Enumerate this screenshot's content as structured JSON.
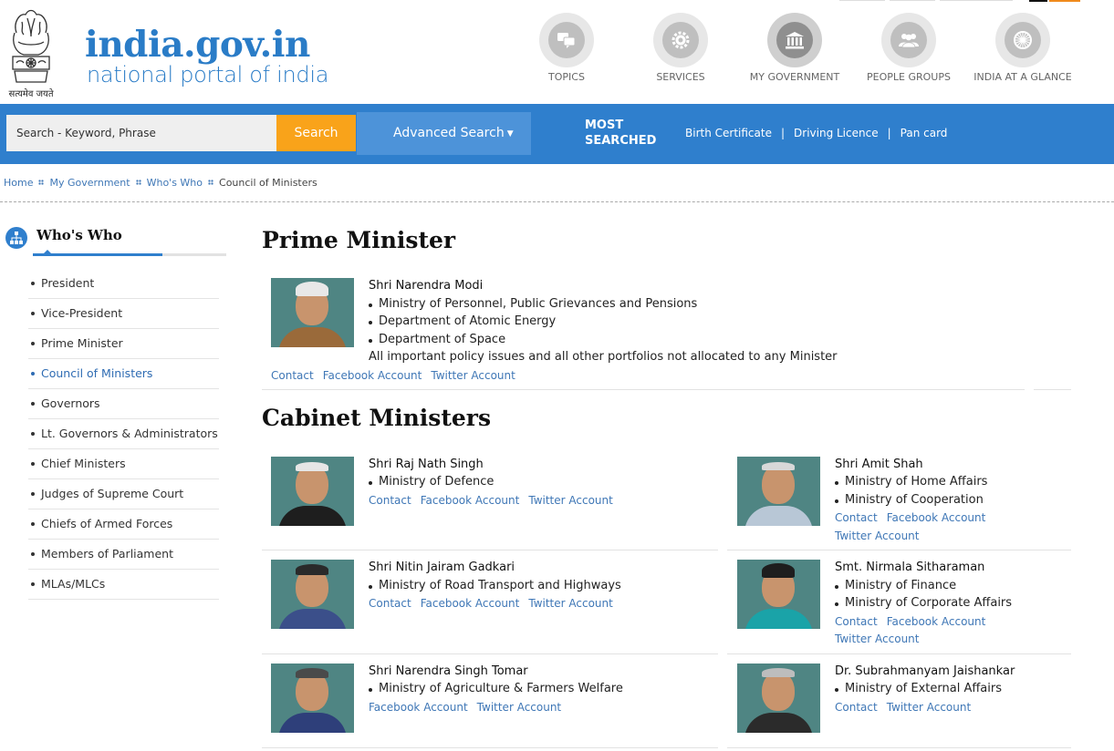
{
  "header": {
    "emblem_caption": "सत्यमेव जयते",
    "site_name": "india.gov.in",
    "site_tagline": "national portal of india",
    "nav": [
      {
        "label": "TOPICS",
        "icon": "chat-bubbles-icon"
      },
      {
        "label": "SERVICES",
        "icon": "gear-icon"
      },
      {
        "label": "MY GOVERNMENT",
        "icon": "government-building-icon"
      },
      {
        "label": "PEOPLE GROUPS",
        "icon": "people-group-icon"
      },
      {
        "label": "INDIA AT A GLANCE",
        "icon": "ashoka-chakra-icon"
      }
    ]
  },
  "search": {
    "placeholder": "Search - Keyword, Phrase",
    "button_label": "Search",
    "advanced_label": "Advanced Search",
    "most_searched_line1": "MOST",
    "most_searched_line2": "SEARCHED",
    "most_searched_links": [
      "Birth Certificate",
      "Driving Licence",
      "Pan card"
    ]
  },
  "breadcrumb": {
    "items": [
      "Home",
      "My Government",
      "Who's Who"
    ],
    "current": "Council of Ministers"
  },
  "sidebar": {
    "title": "Who's Who",
    "items": [
      "President",
      "Vice-President",
      "Prime Minister",
      "Council of Ministers",
      "Governors",
      "Lt. Governors & Administrators",
      "Chief Ministers",
      "Judges of Supreme Court",
      "Chiefs of Armed Forces",
      "Members of Parliament",
      "MLAs/MLCs"
    ],
    "active_item": "Council of Ministers"
  },
  "prime_minister": {
    "heading": "Prime Minister",
    "name": "Shri Narendra Modi",
    "portfolios": [
      "Ministry of Personnel, Public Grievances and Pensions",
      "Department of Atomic Energy",
      "Department of Space"
    ],
    "note": "All important policy issues and all other portfolios not allocated to any Minister",
    "links": [
      "Contact",
      "Facebook Account",
      "Twitter Account"
    ]
  },
  "cabinet": {
    "heading": "Cabinet Ministers",
    "ministers": [
      {
        "name": "Shri Raj Nath Singh",
        "portfolios": [
          "Ministry of Defence"
        ],
        "links": [
          "Contact",
          "Facebook Account",
          "Twitter Account"
        ]
      },
      {
        "name": "Shri Amit Shah",
        "portfolios": [
          "Ministry of Home Affairs",
          "Ministry of Cooperation"
        ],
        "links": [
          "Contact",
          "Facebook Account"
        ],
        "links2": [
          "Twitter Account"
        ]
      },
      {
        "name": "Shri Nitin Jairam Gadkari",
        "portfolios": [
          "Ministry of Road Transport and Highways"
        ],
        "links": [
          "Contact",
          "Facebook Account",
          "Twitter Account"
        ]
      },
      {
        "name": "Smt. Nirmala Sitharaman",
        "portfolios": [
          "Ministry of Finance",
          "Ministry of Corporate Affairs"
        ],
        "links": [
          "Contact",
          "Facebook Account"
        ],
        "links2": [
          "Twitter Account"
        ]
      },
      {
        "name": "Shri Narendra Singh Tomar",
        "portfolios": [
          "Ministry of Agriculture & Farmers Welfare"
        ],
        "links": [
          "Facebook Account",
          "Twitter Account"
        ]
      },
      {
        "name": "Dr. Subrahmanyam Jaishankar",
        "portfolios": [
          "Ministry of External Affairs"
        ],
        "links": [
          "Contact",
          "Twitter Account"
        ]
      }
    ]
  },
  "colors": {
    "brand_blue": "#2f7fcd",
    "search_orange": "#f9a31a",
    "link_blue": "#3f77b6",
    "photo_bg": "#4f8583"
  }
}
